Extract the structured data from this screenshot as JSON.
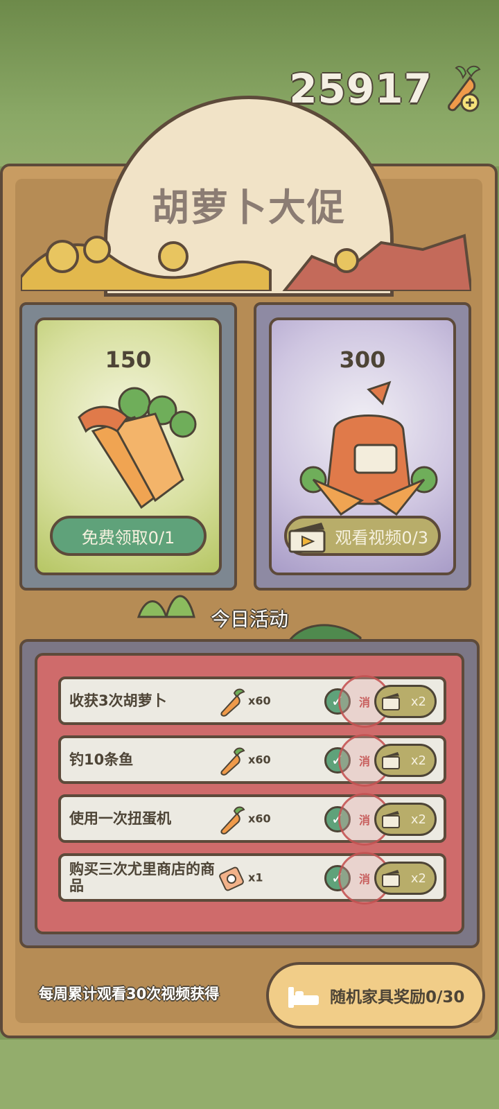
{
  "currency": {
    "amount": "25917",
    "icon": "carrot-add-icon"
  },
  "banner": {
    "title": "胡萝卜大促"
  },
  "offers": [
    {
      "amount": "150",
      "button_label": "免费领取0/1",
      "icon": "carrot-bundle-icon"
    },
    {
      "amount": "300",
      "button_label": "观看视频0/3",
      "icon": "carrot-sack-icon",
      "button_icon": "video-clapper-icon"
    }
  ],
  "daily": {
    "section_title": "今日活动",
    "tasks": [
      {
        "label": "收获3次胡萝卜",
        "reward_icon": "carrot-icon",
        "qty": "x60",
        "stamp": "消",
        "multiplier": "x2"
      },
      {
        "label": "钓10条鱼",
        "reward_icon": "carrot-icon",
        "qty": "x60",
        "stamp": "消",
        "multiplier": "x2"
      },
      {
        "label": "使用一次扭蛋机",
        "reward_icon": "carrot-icon",
        "qty": "x60",
        "stamp": "消",
        "multiplier": "x2"
      },
      {
        "label": "购买三次尤里商店的商品",
        "reward_icon": "ticket-icon",
        "qty": "x1",
        "stamp": "消",
        "multiplier": "x2"
      }
    ]
  },
  "footer": {
    "note": "每周累计观看30次视频获得",
    "button_label": "随机家具奖励0/30",
    "button_icon": "bed-icon"
  },
  "colors": {
    "board": "#c89c62",
    "outline": "#5d4a3a",
    "green_button": "#5fa27a",
    "olive_button": "#b8ad6a",
    "task_panel": "#cf6b6b"
  }
}
